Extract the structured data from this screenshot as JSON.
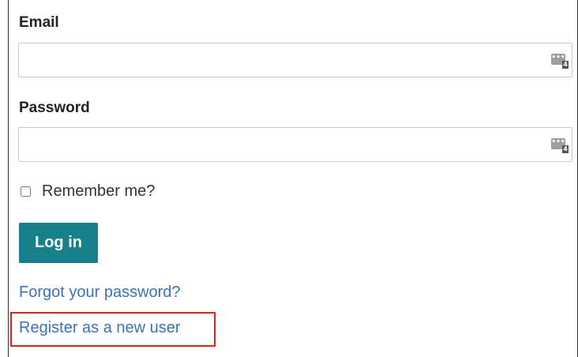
{
  "email": {
    "label": "Email",
    "value": "",
    "icon": "password-manager-icon",
    "badge": "4"
  },
  "password": {
    "label": "Password",
    "value": "",
    "icon": "password-manager-icon",
    "badge": "4"
  },
  "remember": {
    "label": "Remember me?",
    "checked": false
  },
  "login_button": "Log in",
  "forgot_link": "Forgot your password?",
  "register_link": "Register as a new user",
  "colors": {
    "button_bg": "#17808a",
    "link": "#3c73b4",
    "highlight": "#e0201a"
  }
}
